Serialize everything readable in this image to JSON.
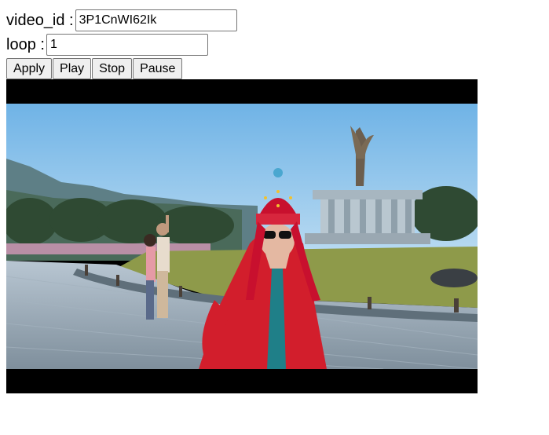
{
  "form": {
    "video_id_label": "video_id :",
    "video_id_value": "3P1CnWI62Ik",
    "loop_label": "loop :",
    "loop_value": "1"
  },
  "buttons": {
    "apply": "Apply",
    "play": "Play",
    "stop": "Stop",
    "pause": "Pause"
  },
  "player": {
    "background": "#000000"
  }
}
